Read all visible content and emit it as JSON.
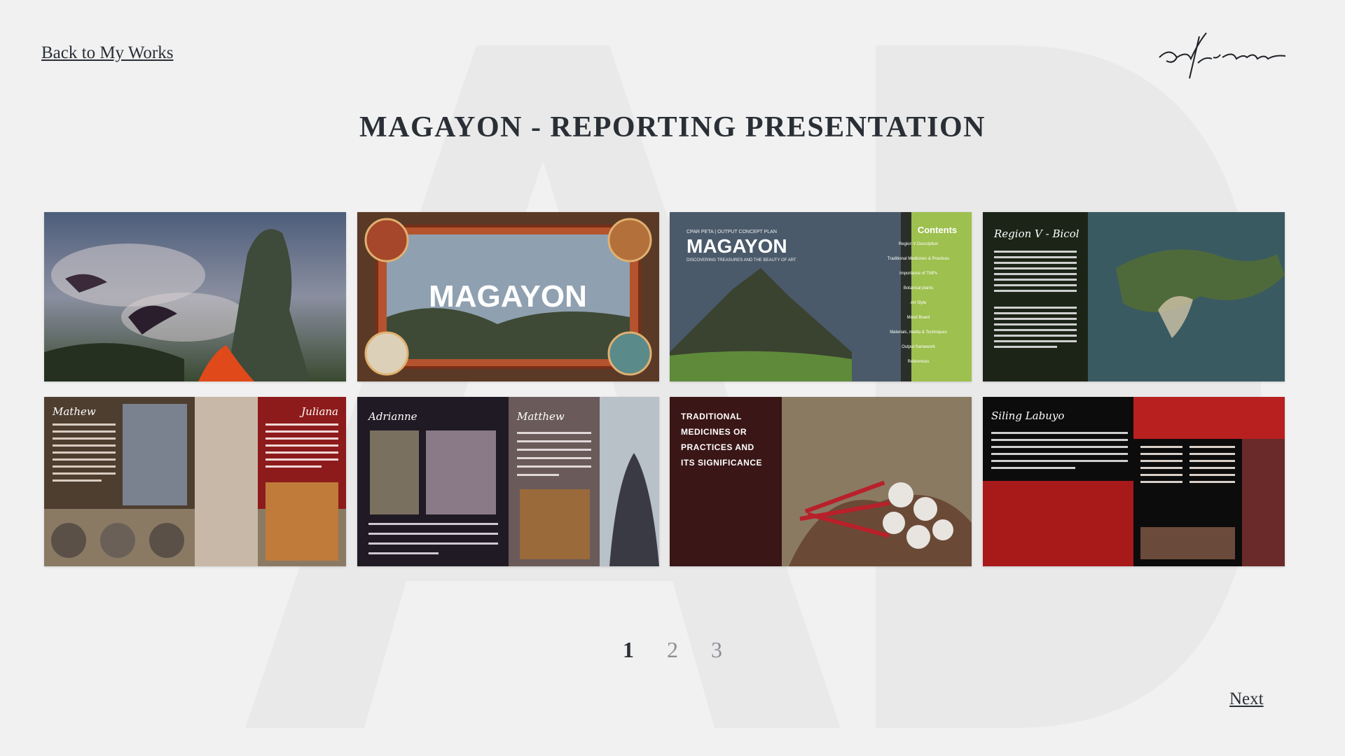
{
  "nav": {
    "back_label": "Back to My Works",
    "next_label": "Next"
  },
  "brand": {
    "signature": "adrianne"
  },
  "title": "MAGAYON - REPORTING PRESENTATION",
  "pagination": {
    "pages": [
      "1",
      "2",
      "3"
    ],
    "current": "1"
  },
  "slides": [
    {
      "name": "slide-dragon-volcano"
    },
    {
      "name": "slide-magayon-title",
      "text": "MAGAYON"
    },
    {
      "name": "slide-contents",
      "kicker": "CPAR PETA | OUTPUT CONCEPT PLAN",
      "title": "MAGAYON",
      "subtitle": "DISCOVERING TREASURES AND THE BEAUTY OF ART",
      "contents_heading": "Contents",
      "items": [
        "Region V Description",
        "Traditional Medicines & Practices",
        "Importance of TMPs",
        "Botanical plants",
        "Art Style",
        "Mood Board",
        "Materials, media & Techniques",
        "Output framework",
        "References"
      ]
    },
    {
      "name": "slide-region-v",
      "heading": "Region V - Bicol"
    },
    {
      "name": "slide-mathew-juliana",
      "left_name": "Mathew",
      "right_name": "Juliana"
    },
    {
      "name": "slide-adrianne-matthew",
      "left_name": "Adrianne",
      "right_name": "Matthew"
    },
    {
      "name": "slide-traditional-medicines",
      "lines": [
        "TRADITIONAL",
        "MEDICINES OR",
        "PRACTICES AND",
        "ITS SIGNIFICANCE"
      ]
    },
    {
      "name": "slide-siling-labuyo",
      "heading": "Siling Labuyo"
    }
  ],
  "colors": {
    "background": "#f1f1f1",
    "text": "#2a2f36",
    "contents_green": "#9dc04f",
    "maroon": "#3a1616",
    "juliana_red": "#8e1b1b"
  }
}
